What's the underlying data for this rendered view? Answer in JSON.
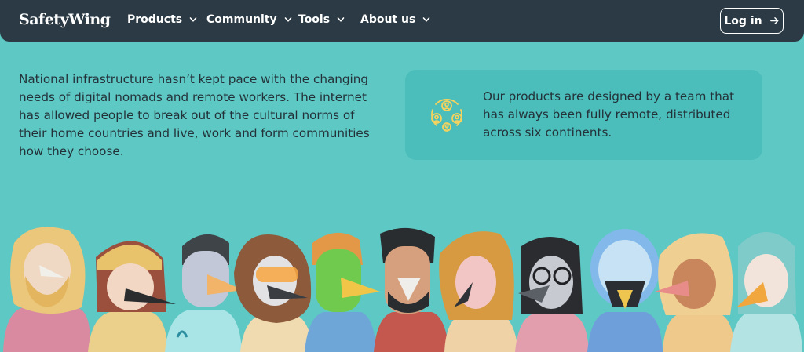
{
  "header": {
    "logo_text": "SafetyWing",
    "nav": [
      {
        "label": "Products"
      },
      {
        "label": "Community"
      },
      {
        "label": "Tools"
      },
      {
        "label": "About us"
      }
    ],
    "login_label": "Log in"
  },
  "intro": {
    "text": "National infrastructure hasn’t kept pace with the changing needs of digital nomads and remote workers. The internet has allowed people to break out of the cultural norms of their home countries and live, work and form communities how they choose."
  },
  "card": {
    "text": "Our products are designed by a team that has always been fully remote, distributed across six continents.",
    "icon": "globe-people-icon"
  },
  "illustration": {
    "subject": "team-of-bird-masked-characters",
    "count": 11
  },
  "colors": {
    "background": "#5ec8c4",
    "navbar": "#2b3a44",
    "card": "#4bbdba",
    "text": "#233138",
    "icon": "#f4d35e"
  }
}
